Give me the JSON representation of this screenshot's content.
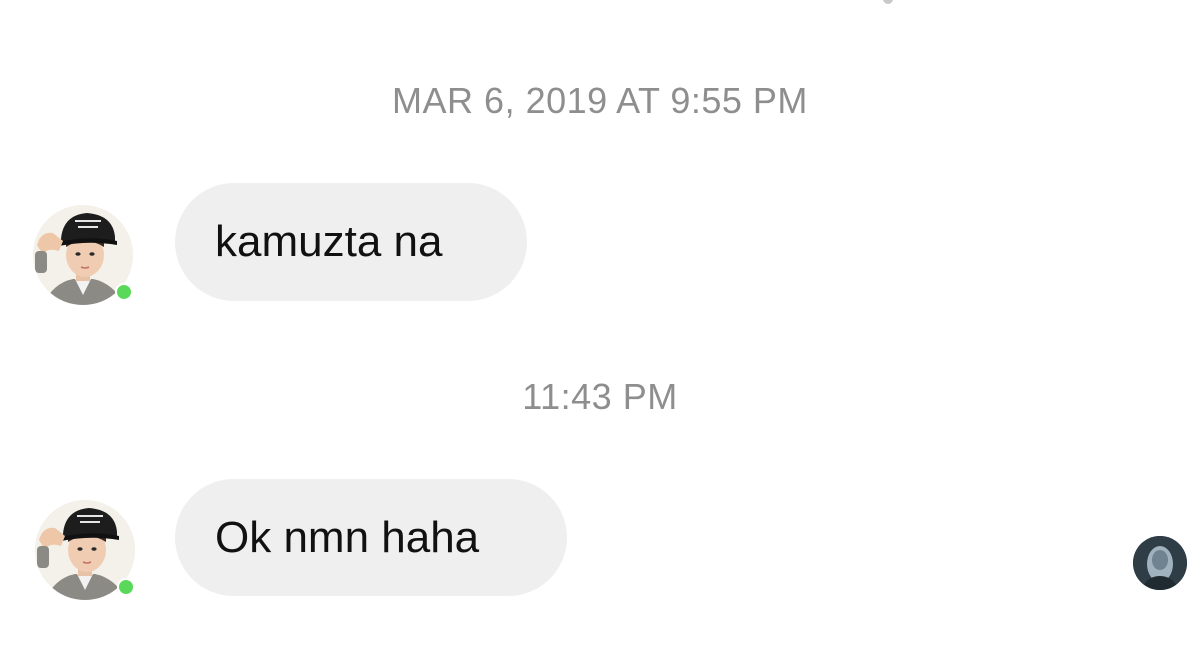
{
  "conversation": {
    "messages": [
      {
        "timestamp": "MAR 6, 2019 AT 9:55 PM",
        "text": "kamuzta na"
      },
      {
        "timestamp": "11:43 PM",
        "text": "Ok nmn haha"
      }
    ]
  },
  "colors": {
    "background": "#ffffff",
    "bubble": "#efefef",
    "timestamp": "#8e8e8e",
    "message_text": "#111111",
    "online": "#5ad85a"
  },
  "icons": {
    "sender_avatar": "avatar",
    "online_status": "online-status-icon",
    "seen_indicator": "seen-avatar"
  }
}
